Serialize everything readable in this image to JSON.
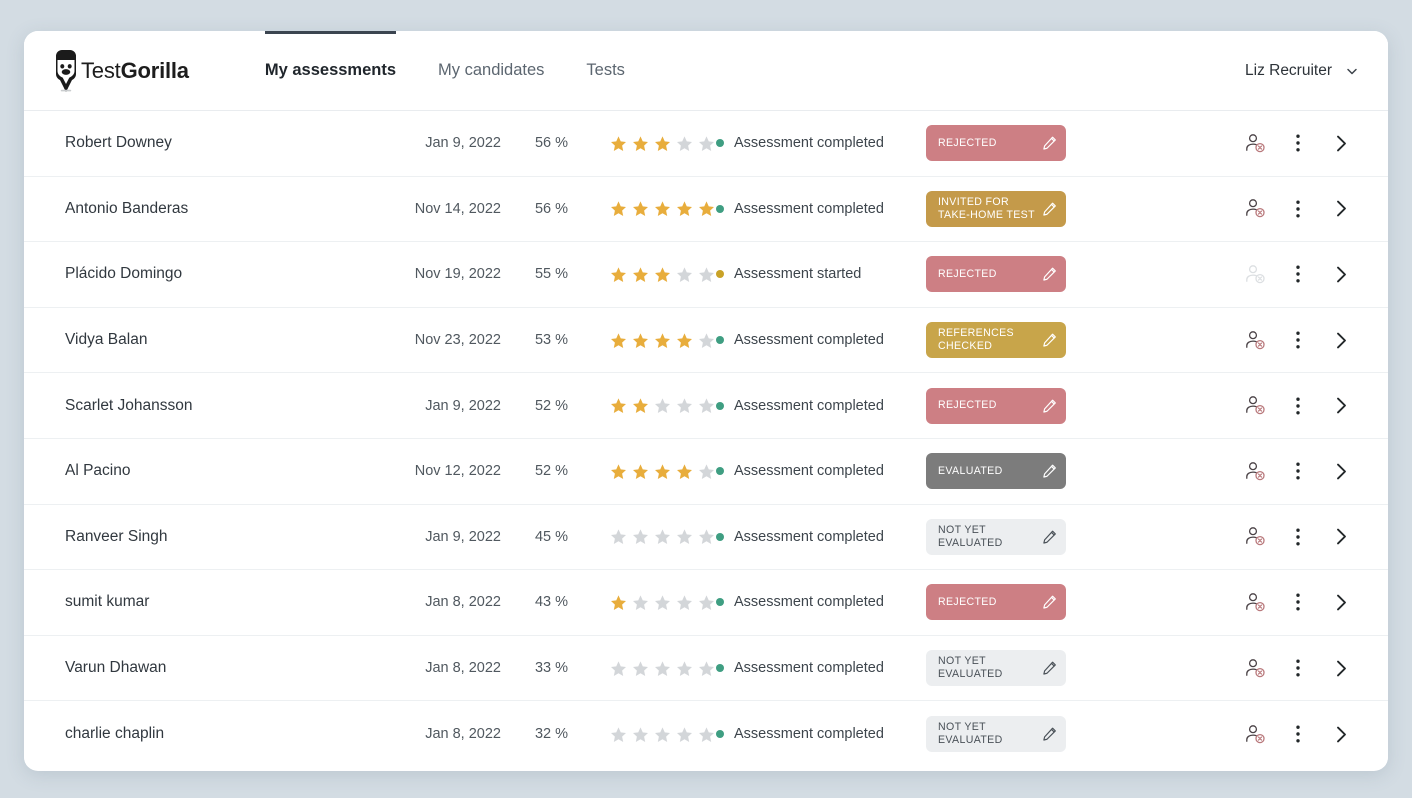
{
  "brand": {
    "logo_icon": "gorilla-pencil-logo-icon",
    "name_light": "Test",
    "name_bold": "Gorilla"
  },
  "header": {
    "nav": [
      {
        "label": "My assessments",
        "active": true
      },
      {
        "label": "My candidates",
        "active": false
      },
      {
        "label": "Tests",
        "active": false
      }
    ],
    "user": {
      "name": "Liz Recruiter",
      "chevron_icon": "chevron-down-icon"
    }
  },
  "colors": {
    "page_bg": "#d3dce3",
    "card_bg": "#ffffff",
    "active_tab_underline": "#3b4550",
    "star_filled": "#e8ad3c",
    "star_empty": "#d3d6d9",
    "dot_completed": "#3f9e82",
    "dot_started": "#c9a227",
    "badge_rejected_bg": "#cd7f84",
    "badge_invited_bg": "#c49a4a",
    "badge_references_bg": "#c8a54a",
    "badge_evaluated_bg": "#7c7c7c",
    "badge_not_evaluated_bg": "#eceef0",
    "badge_not_evaluated_text": "#4a5158",
    "icon_person": "#4a4246",
    "icon_person_disabled": "#dcdfe2"
  },
  "table": {
    "rows": [
      {
        "name": "Robert Downey",
        "date": "Jan 9, 2022",
        "score": "56 %",
        "stars": 3,
        "status": "Assessment completed",
        "status_type": "completed",
        "badge": "REJECTED",
        "badge_type": "rejected",
        "person_icon": "reject-candidate-icon",
        "person_disabled": false,
        "menu_icon": "more-options-icon",
        "open_icon": "chevron-right-icon"
      },
      {
        "name": "Antonio Banderas",
        "date": "Nov 14, 2022",
        "score": "56 %",
        "stars": 5,
        "status": "Assessment completed",
        "status_type": "completed",
        "badge": "INVITED FOR TAKE-HOME TEST",
        "badge_type": "invited",
        "person_icon": "reject-candidate-icon",
        "person_disabled": false,
        "menu_icon": "more-options-icon",
        "open_icon": "chevron-right-icon"
      },
      {
        "name": "Plácido Domingo",
        "date": "Nov 19, 2022",
        "score": "55 %",
        "stars": 3,
        "status": "Assessment started",
        "status_type": "started",
        "badge": "REJECTED",
        "badge_type": "rejected",
        "person_icon": "reject-candidate-icon",
        "person_disabled": true,
        "menu_icon": "more-options-icon",
        "open_icon": "chevron-right-icon"
      },
      {
        "name": "Vidya Balan",
        "date": "Nov 23, 2022",
        "score": "53 %",
        "stars": 4,
        "status": "Assessment completed",
        "status_type": "completed",
        "badge": "REFERENCES CHECKED",
        "badge_type": "references",
        "person_icon": "reject-candidate-icon",
        "person_disabled": false,
        "menu_icon": "more-options-icon",
        "open_icon": "chevron-right-icon"
      },
      {
        "name": "Scarlet Johansson",
        "date": "Jan 9, 2022",
        "score": "52 %",
        "stars": 2,
        "status": "Assessment completed",
        "status_type": "completed",
        "badge": "REJECTED",
        "badge_type": "rejected",
        "person_icon": "reject-candidate-icon",
        "person_disabled": false,
        "menu_icon": "more-options-icon",
        "open_icon": "chevron-right-icon"
      },
      {
        "name": "Al Pacino",
        "date": "Nov 12, 2022",
        "score": "52 %",
        "stars": 4,
        "status": "Assessment completed",
        "status_type": "completed",
        "badge": "EVALUATED",
        "badge_type": "evaluated",
        "person_icon": "reject-candidate-icon",
        "person_disabled": false,
        "menu_icon": "more-options-icon",
        "open_icon": "chevron-right-icon"
      },
      {
        "name": "Ranveer Singh",
        "date": "Jan 9, 2022",
        "score": "45 %",
        "stars": 0,
        "status": "Assessment completed",
        "status_type": "completed",
        "badge": "NOT YET EVALUATED",
        "badge_type": "not-evaluated",
        "person_icon": "reject-candidate-icon",
        "person_disabled": false,
        "menu_icon": "more-options-icon",
        "open_icon": "chevron-right-icon"
      },
      {
        "name": "sumit kumar",
        "date": "Jan 8, 2022",
        "score": "43 %",
        "stars": 1,
        "status": "Assessment completed",
        "status_type": "completed",
        "badge": "REJECTED",
        "badge_type": "rejected",
        "person_icon": "reject-candidate-icon",
        "person_disabled": false,
        "menu_icon": "more-options-icon",
        "open_icon": "chevron-right-icon"
      },
      {
        "name": "Varun Dhawan",
        "date": "Jan 8, 2022",
        "score": "33 %",
        "stars": 0,
        "status": "Assessment completed",
        "status_type": "completed",
        "badge": "NOT YET EVALUATED",
        "badge_type": "not-evaluated",
        "person_icon": "reject-candidate-icon",
        "person_disabled": false,
        "menu_icon": "more-options-icon",
        "open_icon": "chevron-right-icon"
      },
      {
        "name": "charlie chaplin",
        "date": "Jan 8, 2022",
        "score": "32 %",
        "stars": 0,
        "status": "Assessment completed",
        "status_type": "completed",
        "badge": "NOT YET EVALUATED",
        "badge_type": "not-evaluated",
        "person_icon": "reject-candidate-icon",
        "person_disabled": false,
        "menu_icon": "more-options-icon",
        "open_icon": "chevron-right-icon"
      }
    ]
  }
}
